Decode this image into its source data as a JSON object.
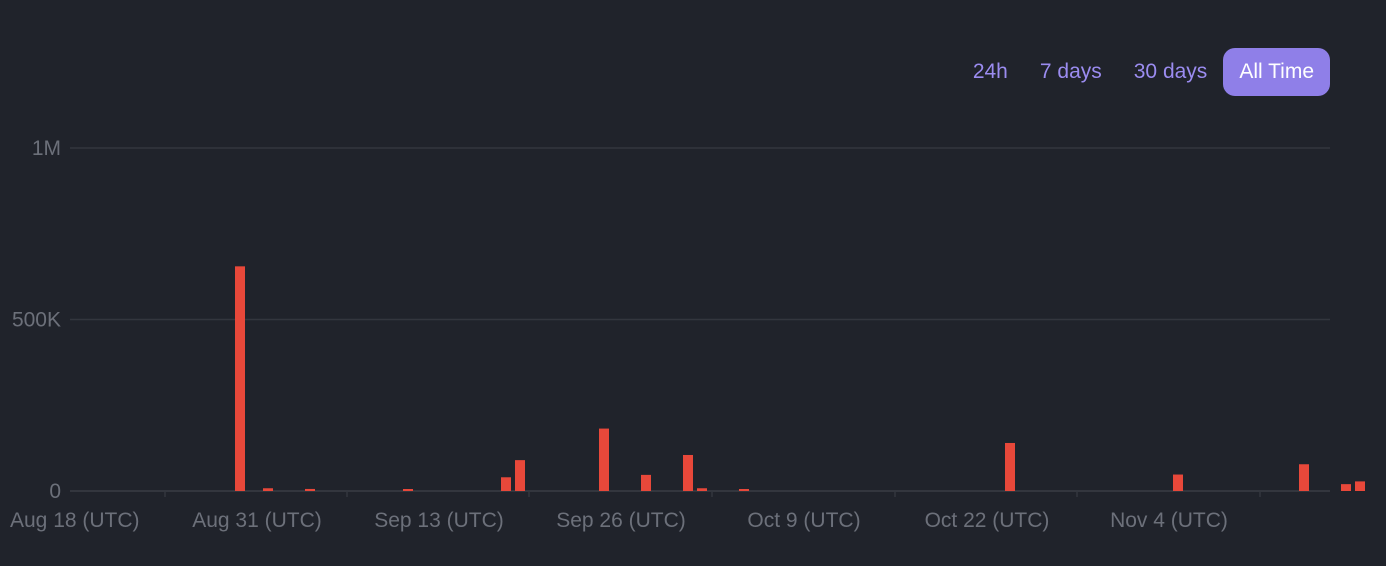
{
  "range_selector": {
    "options": [
      {
        "label": "24h",
        "active": false
      },
      {
        "label": "7 days",
        "active": false
      },
      {
        "label": "30 days",
        "active": false
      },
      {
        "label": "All Time",
        "active": true
      }
    ]
  },
  "colors": {
    "background": "#20232b",
    "bar": "#e8483a",
    "grid": "#33363e",
    "tick_text": "#6c707a",
    "tab_text": "#9b8cf0",
    "tab_active_bg": "#8f7fe8"
  },
  "chart_data": {
    "type": "bar",
    "title": "",
    "xlabel": "",
    "ylabel": "",
    "ylim": [
      0,
      1000000
    ],
    "xlim": [
      "2024-08-18",
      "2024-11-17"
    ],
    "grid": true,
    "legend": "none",
    "y_ticks": [
      {
        "value": 0,
        "label": "0"
      },
      {
        "value": 500000,
        "label": "500K"
      },
      {
        "value": 1000000,
        "label": "1M"
      }
    ],
    "x_ticks": [
      {
        "date": "2024-08-18",
        "label": "Aug 18 (UTC)"
      },
      {
        "date": "2024-08-31",
        "label": "Aug 31 (UTC)"
      },
      {
        "date": "2024-09-13",
        "label": "Sep 13 (UTC)"
      },
      {
        "date": "2024-09-26",
        "label": "Sep 26 (UTC)"
      },
      {
        "date": "2024-10-09",
        "label": "Oct 9 (UTC)"
      },
      {
        "date": "2024-10-22",
        "label": "Oct 22 (UTC)"
      },
      {
        "date": "2024-11-04",
        "label": "Nov 4 (UTC)"
      }
    ],
    "series": [
      {
        "values": [
          {
            "x": "2024-08-30",
            "y": 655000
          },
          {
            "x": "2024-09-01",
            "y": 8000
          },
          {
            "x": "2024-09-04",
            "y": 6000
          },
          {
            "x": "2024-09-11",
            "y": 4000
          },
          {
            "x": "2024-09-18",
            "y": 40000
          },
          {
            "x": "2024-09-19",
            "y": 90000
          },
          {
            "x": "2024-09-25",
            "y": 182000
          },
          {
            "x": "2024-09-28",
            "y": 47000
          },
          {
            "x": "2024-10-01",
            "y": 105000
          },
          {
            "x": "2024-10-02",
            "y": 8000
          },
          {
            "x": "2024-10-05",
            "y": 4000
          },
          {
            "x": "2024-10-24",
            "y": 140000
          },
          {
            "x": "2024-11-05",
            "y": 48000
          },
          {
            "x": "2024-11-14",
            "y": 78000
          },
          {
            "x": "2024-11-17",
            "y": 20000
          },
          {
            "x": "2024-11-18",
            "y": 28000
          }
        ]
      }
    ]
  }
}
